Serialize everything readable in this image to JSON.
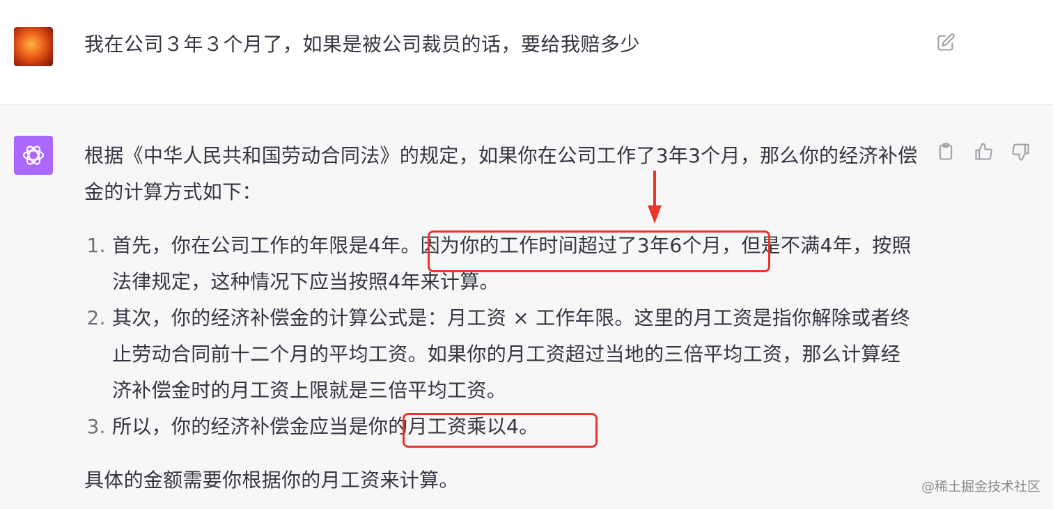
{
  "user_message": {
    "avatar": "user-avatar",
    "text": "我在公司３年３个月了，如果是被公司裁员的话，要给我赔多少",
    "edit_icon": "edit-icon"
  },
  "assistant_message": {
    "avatar": "openai-logo-icon",
    "intro": "根据《中华人民共和国劳动合同法》的规定，如果你在公司工作了3年3个月，那么你的经济补偿金的计算方式如下：",
    "list": [
      "首先，你在公司工作的年限是4年。因为你的工作时间超过了3年6个月，但是不满4年，按照法律规定，这种情况下应当按照4年来计算。",
      "其次，你的经济补偿金的计算公式是：月工资 × 工作年限。这里的月工资是指你解除或者终止劳动合同前十二个月的平均工资。如果你的月工资超过当地的三倍平均工资，那么计算经济补偿金时的月工资上限就是三倍平均工资。",
      "所以，你的经济补偿金应当是你的月工资乘以4。"
    ],
    "closing": "具体的金额需要你根据你的月工资来计算。",
    "actions": [
      "clipboard-icon",
      "thumbs-up-icon",
      "thumbs-down-icon"
    ]
  },
  "annotation": {
    "color": "#e8362d"
  },
  "watermark": "@稀土掘金技术社区"
}
